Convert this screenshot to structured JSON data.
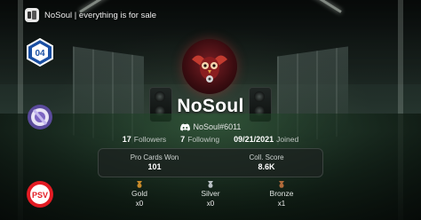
{
  "header": {
    "title": "NoSoul | everything is for sale"
  },
  "profile": {
    "username": "NoSoul",
    "discord_tag": "NoSoul#6011",
    "followers": {
      "count": "17",
      "label": "Followers"
    },
    "following": {
      "count": "7",
      "label": "Following"
    },
    "joined": {
      "date": "09/21/2021",
      "label": "Joined"
    }
  },
  "panel": {
    "pro_cards_label": "Pro Cards Won",
    "pro_cards_value": "101",
    "coll_score_label": "Coll. Score",
    "coll_score_value": "8.6K"
  },
  "medals": [
    {
      "name": "Gold",
      "count": "x0",
      "color": "#c88a2a"
    },
    {
      "name": "Silver",
      "count": "x0",
      "color": "#b9c0c4"
    },
    {
      "name": "Bronze",
      "count": "x1",
      "color": "#b06a3a"
    }
  ],
  "badges": {
    "schalke_text": "04",
    "psv_text": "PSV"
  },
  "colors": {
    "accent": "#ffffff",
    "discord": "#ffffff"
  }
}
